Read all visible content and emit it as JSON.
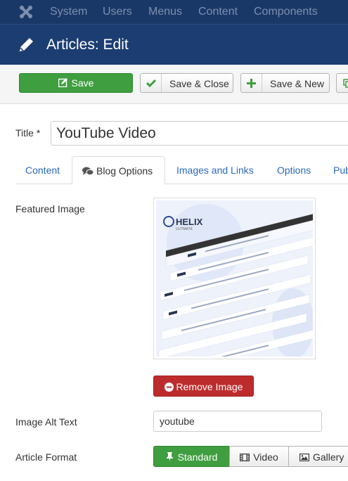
{
  "topnav": {
    "items": [
      {
        "label": "System"
      },
      {
        "label": "Users"
      },
      {
        "label": "Menus"
      },
      {
        "label": "Content"
      },
      {
        "label": "Components"
      }
    ]
  },
  "header": {
    "title": "Articles: Edit",
    "icon": "pencil-icon"
  },
  "toolbar": {
    "save_label": "Save",
    "save_close_label": "Save & Close",
    "save_new_label": "Save & New"
  },
  "form": {
    "title_label": "Title *",
    "title_value": "YouTube Video",
    "tabs": [
      {
        "label": "Content",
        "active": false
      },
      {
        "label": "Blog Options",
        "active": true
      },
      {
        "label": "Images and Links",
        "active": false
      },
      {
        "label": "Options",
        "active": false
      },
      {
        "label": "Pub",
        "active": false
      }
    ],
    "featured_image_label": "Featured Image",
    "featured_image_preview": {
      "logo_text": "HELIX",
      "logo_subtext": "ULTIMATE"
    },
    "remove_image_label": "Remove Image",
    "alt_text_label": "Image Alt Text",
    "alt_text_value": "youtube",
    "article_format_label": "Article Format",
    "format_options": [
      {
        "label": "Standard",
        "active": true
      },
      {
        "label": "Video",
        "active": false
      },
      {
        "label": "Gallery",
        "active": false
      }
    ]
  },
  "colors": {
    "nav_bg": "#1a3867",
    "header_bg": "#1c3d72",
    "success": "#3f9e3f",
    "danger": "#bd2c2c",
    "link": "#2a69b8"
  }
}
